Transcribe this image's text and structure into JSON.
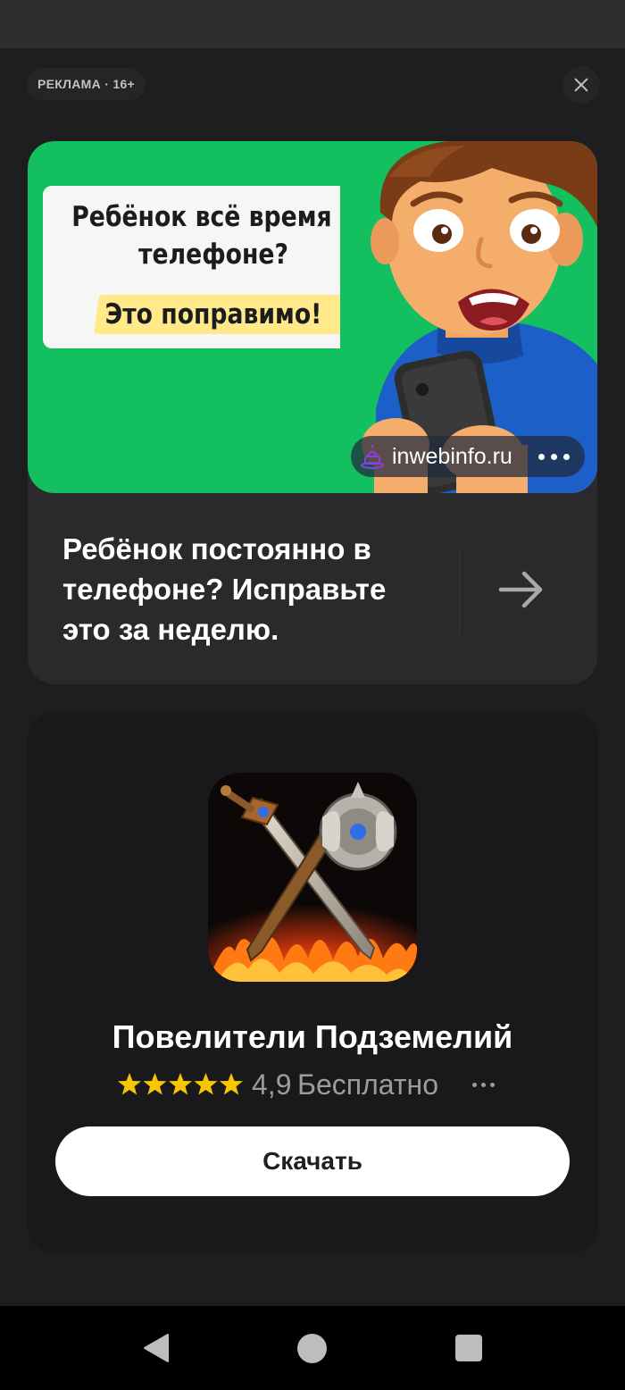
{
  "ad": {
    "label": "РЕКЛАМА · 16+",
    "banner": {
      "headline": "Ребёнок всё время в телефоне?",
      "highlight": "Это поправимо!",
      "source_domain": "inwebinfo.ru",
      "title": "Ребёнок постоянно в телефоне? Исправьте это за неделю."
    },
    "app": {
      "name": "Повелители Подземелий",
      "rating": "4,9",
      "stars": 5,
      "price": "Бесплатно",
      "download_label": "Скачать"
    }
  },
  "colors": {
    "banner_green": "#13bf5e",
    "highlight_yellow": "#ffe98a",
    "star_yellow": "#f7c600",
    "card_bg": "#2a2a2d",
    "app_card_bg": "#19191b",
    "background": "#1e1e20"
  },
  "icons": [
    "close-icon",
    "favicon-icon",
    "more-icon",
    "arrow-right-icon",
    "star-icon",
    "nav-back-icon",
    "nav-home-icon",
    "nav-recents-icon"
  ]
}
